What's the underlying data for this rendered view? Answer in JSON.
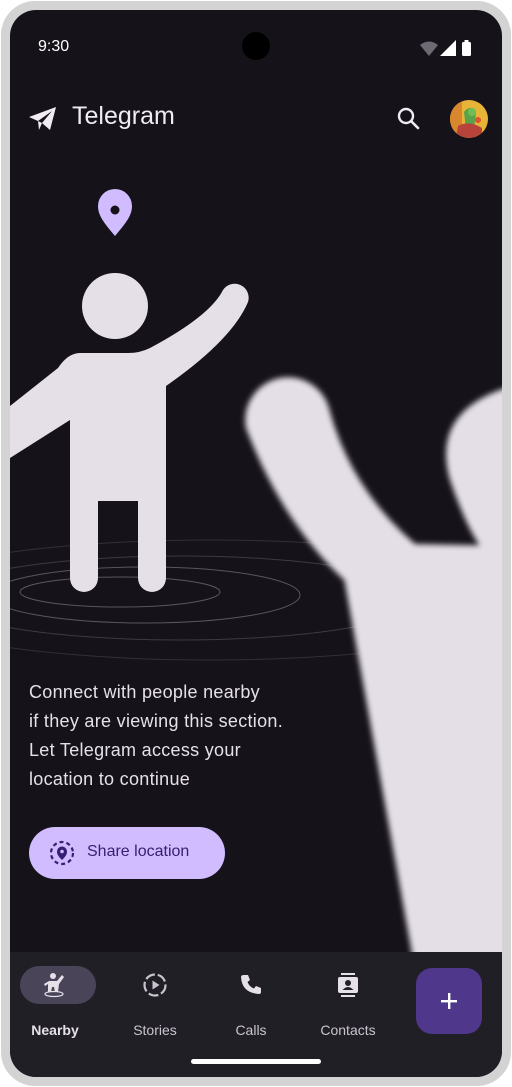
{
  "status_bar": {
    "time": "9:30"
  },
  "app_bar": {
    "title": "Telegram"
  },
  "content": {
    "description_lines": [
      "Connect with people nearby",
      "if they are viewing this section.",
      "Let Telegram access your",
      "location to continue"
    ],
    "share_button_label": "Share location"
  },
  "bottom_nav": {
    "items": [
      {
        "label": "Nearby",
        "icon": "person-nearby-icon",
        "active": true
      },
      {
        "label": "Stories",
        "icon": "stories-icon",
        "active": false
      },
      {
        "label": "Calls",
        "icon": "phone-icon",
        "active": false
      },
      {
        "label": "Contacts",
        "icon": "contacts-icon",
        "active": false
      }
    ],
    "fab_icon": "plus-icon"
  },
  "colors": {
    "background": "#16121a",
    "accent": "#d0bcff",
    "accent_text": "#381e72",
    "figure": "#e5dfe8",
    "fab": "#4f378b",
    "nav_bar": "#211f26"
  }
}
